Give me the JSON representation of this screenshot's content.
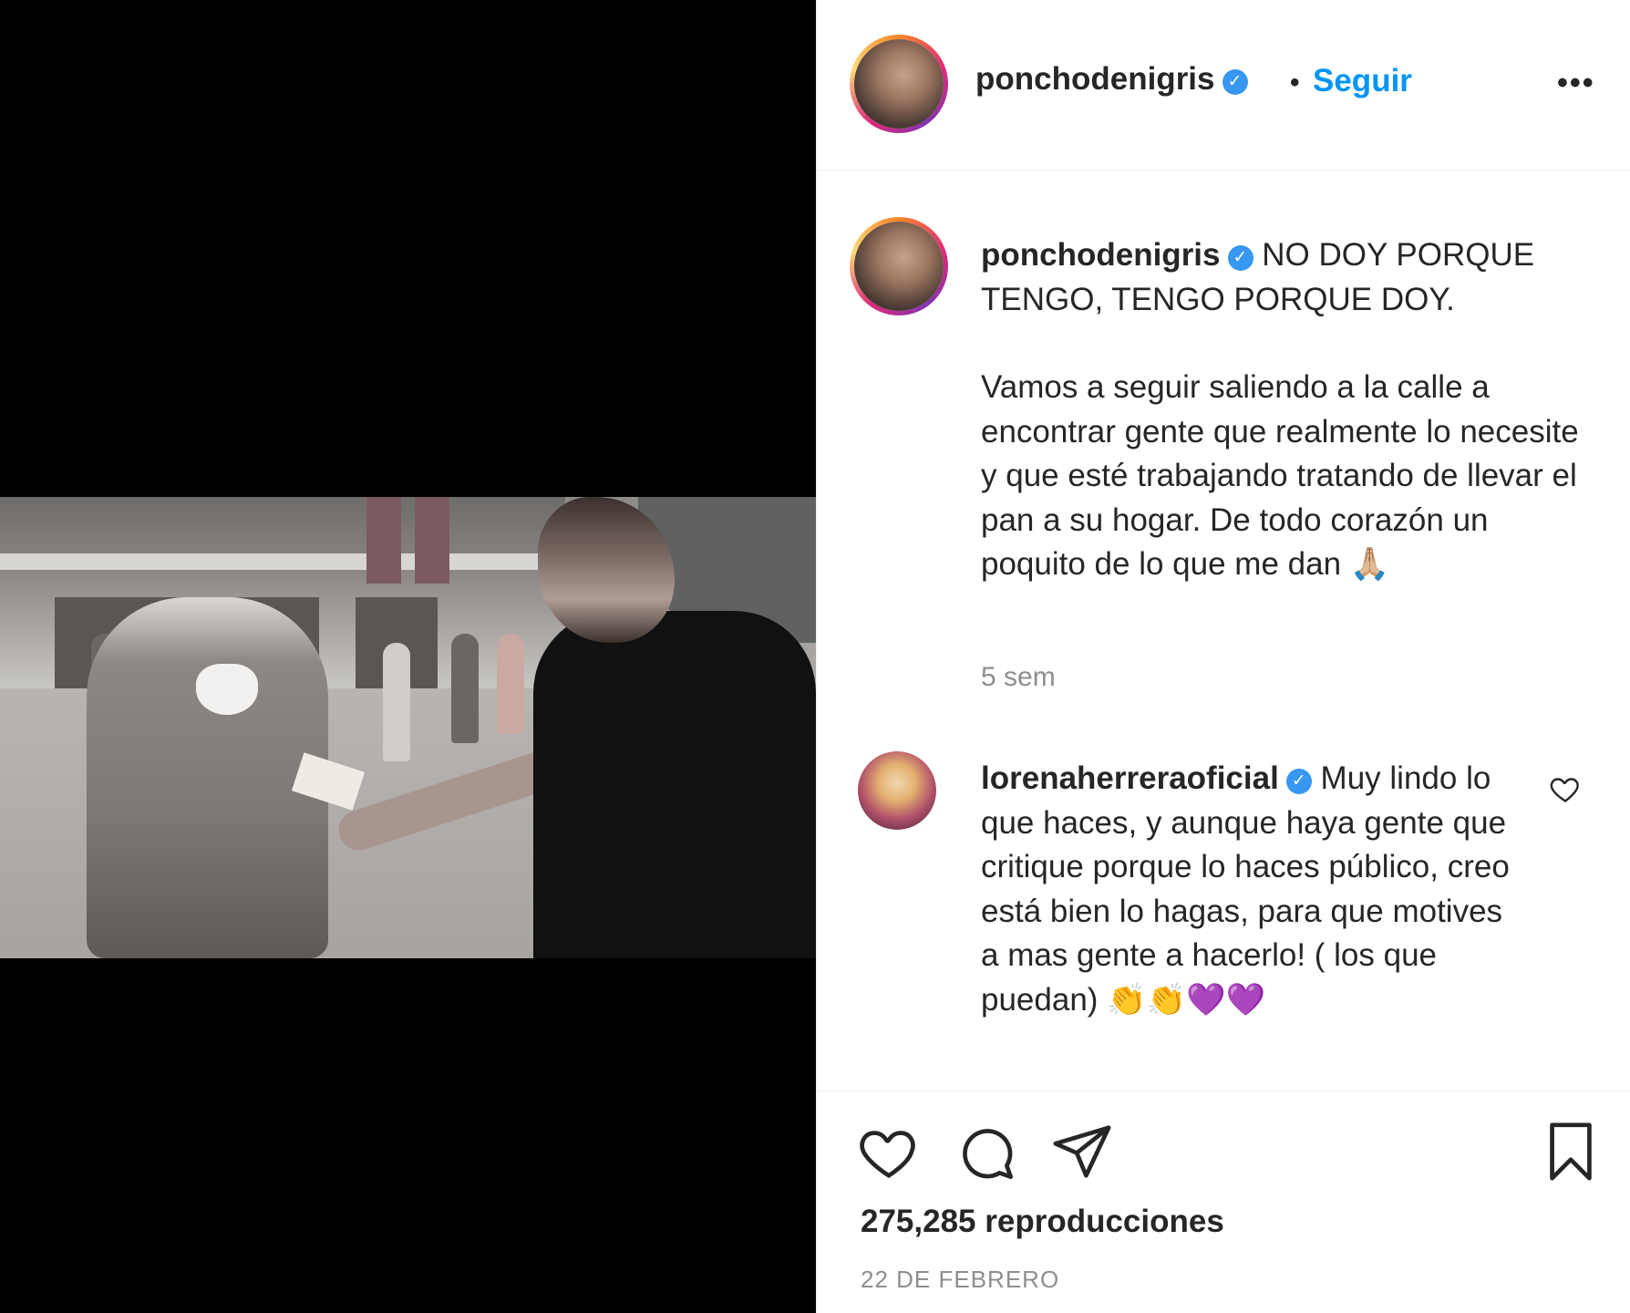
{
  "post": {
    "username": "ponchodenigris",
    "follow_label": "Seguir",
    "separator": "•",
    "more_label": "•••",
    "caption_line1": "NO DOY PORQUE TENGO, TENGO PORQUE DOY.",
    "caption_line2": "Vamos a seguir saliendo a la calle a encontrar gente que realmente lo necesite y que esté trabajando tratando de llevar el pan a su hogar. De todo corazón un poquito de lo que me dan 🙏🏼",
    "caption_time": "5 sem",
    "views_count": "275,285 reproducciones",
    "date": "22 DE FEBRERO"
  },
  "comment": {
    "username": "lorenaherreraoficial",
    "text": "Muy lindo lo que haces, y aunque haya gente que critique porque lo haces público, creo está bien lo hagas, para que motives a mas gente a hacerlo! ( los que puedan) 👏👏💜💜"
  },
  "icons": {
    "verified": "verified-badge-icon",
    "like": "heart-icon",
    "comment": "comment-icon",
    "share": "paper-plane-icon",
    "save": "bookmark-icon"
  },
  "colors": {
    "accent": "#0095f6",
    "verified": "#3897f0",
    "muted": "#8e8e8e",
    "text": "#262626"
  }
}
